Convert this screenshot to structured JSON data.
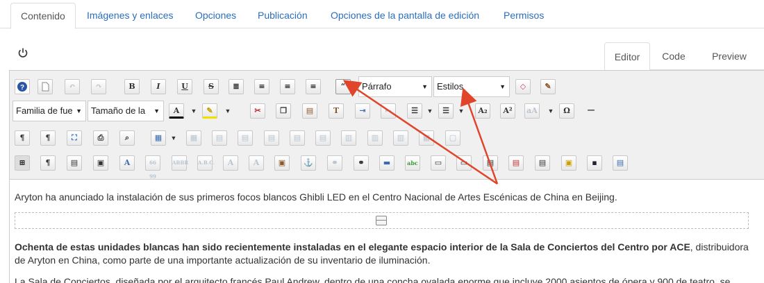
{
  "tabs": [
    {
      "label": "Contenido",
      "active": true
    },
    {
      "label": "Imágenes y enlaces"
    },
    {
      "label": "Opciones"
    },
    {
      "label": "Publicación"
    },
    {
      "label": "Opciones de la pantalla de edición"
    },
    {
      "label": "Permisos"
    }
  ],
  "view_tabs": [
    {
      "label": "Editor",
      "active": true
    },
    {
      "label": "Code"
    },
    {
      "label": "Preview"
    }
  ],
  "toolbar": {
    "format_select": "Párrafo",
    "styles_select": "Estilos",
    "font_family_select": "Familia de fue",
    "font_size_select": "Tamaño de la"
  },
  "content": {
    "p1": "Aryton ha anunciado la instalación de sus primeros focos blancos Ghibli LED en el Centro Nacional de Artes Escénicas de China en Beijing.",
    "p2_bold": "Ochenta de estas unidades blancas han sido recientemente instaladas en el elegante espacio interior de la Sala de Conciertos del Centro por ACE",
    "p2_rest": ", distribuidora de Aryton en China, como parte de una importante actualización de su inventario de iluminación.",
    "p3": "La Sala de Conciertos, diseñada por el arquitecto francés Paul Andrew, dentro de una concha ovalada enorme que incluye 2000 asientos de ópera y 900 de teatro, se"
  },
  "colors": {
    "link": "#2a6ebb",
    "annotation_arrow": "#e0452b",
    "toolbar_bg": "#f0f0f0"
  }
}
